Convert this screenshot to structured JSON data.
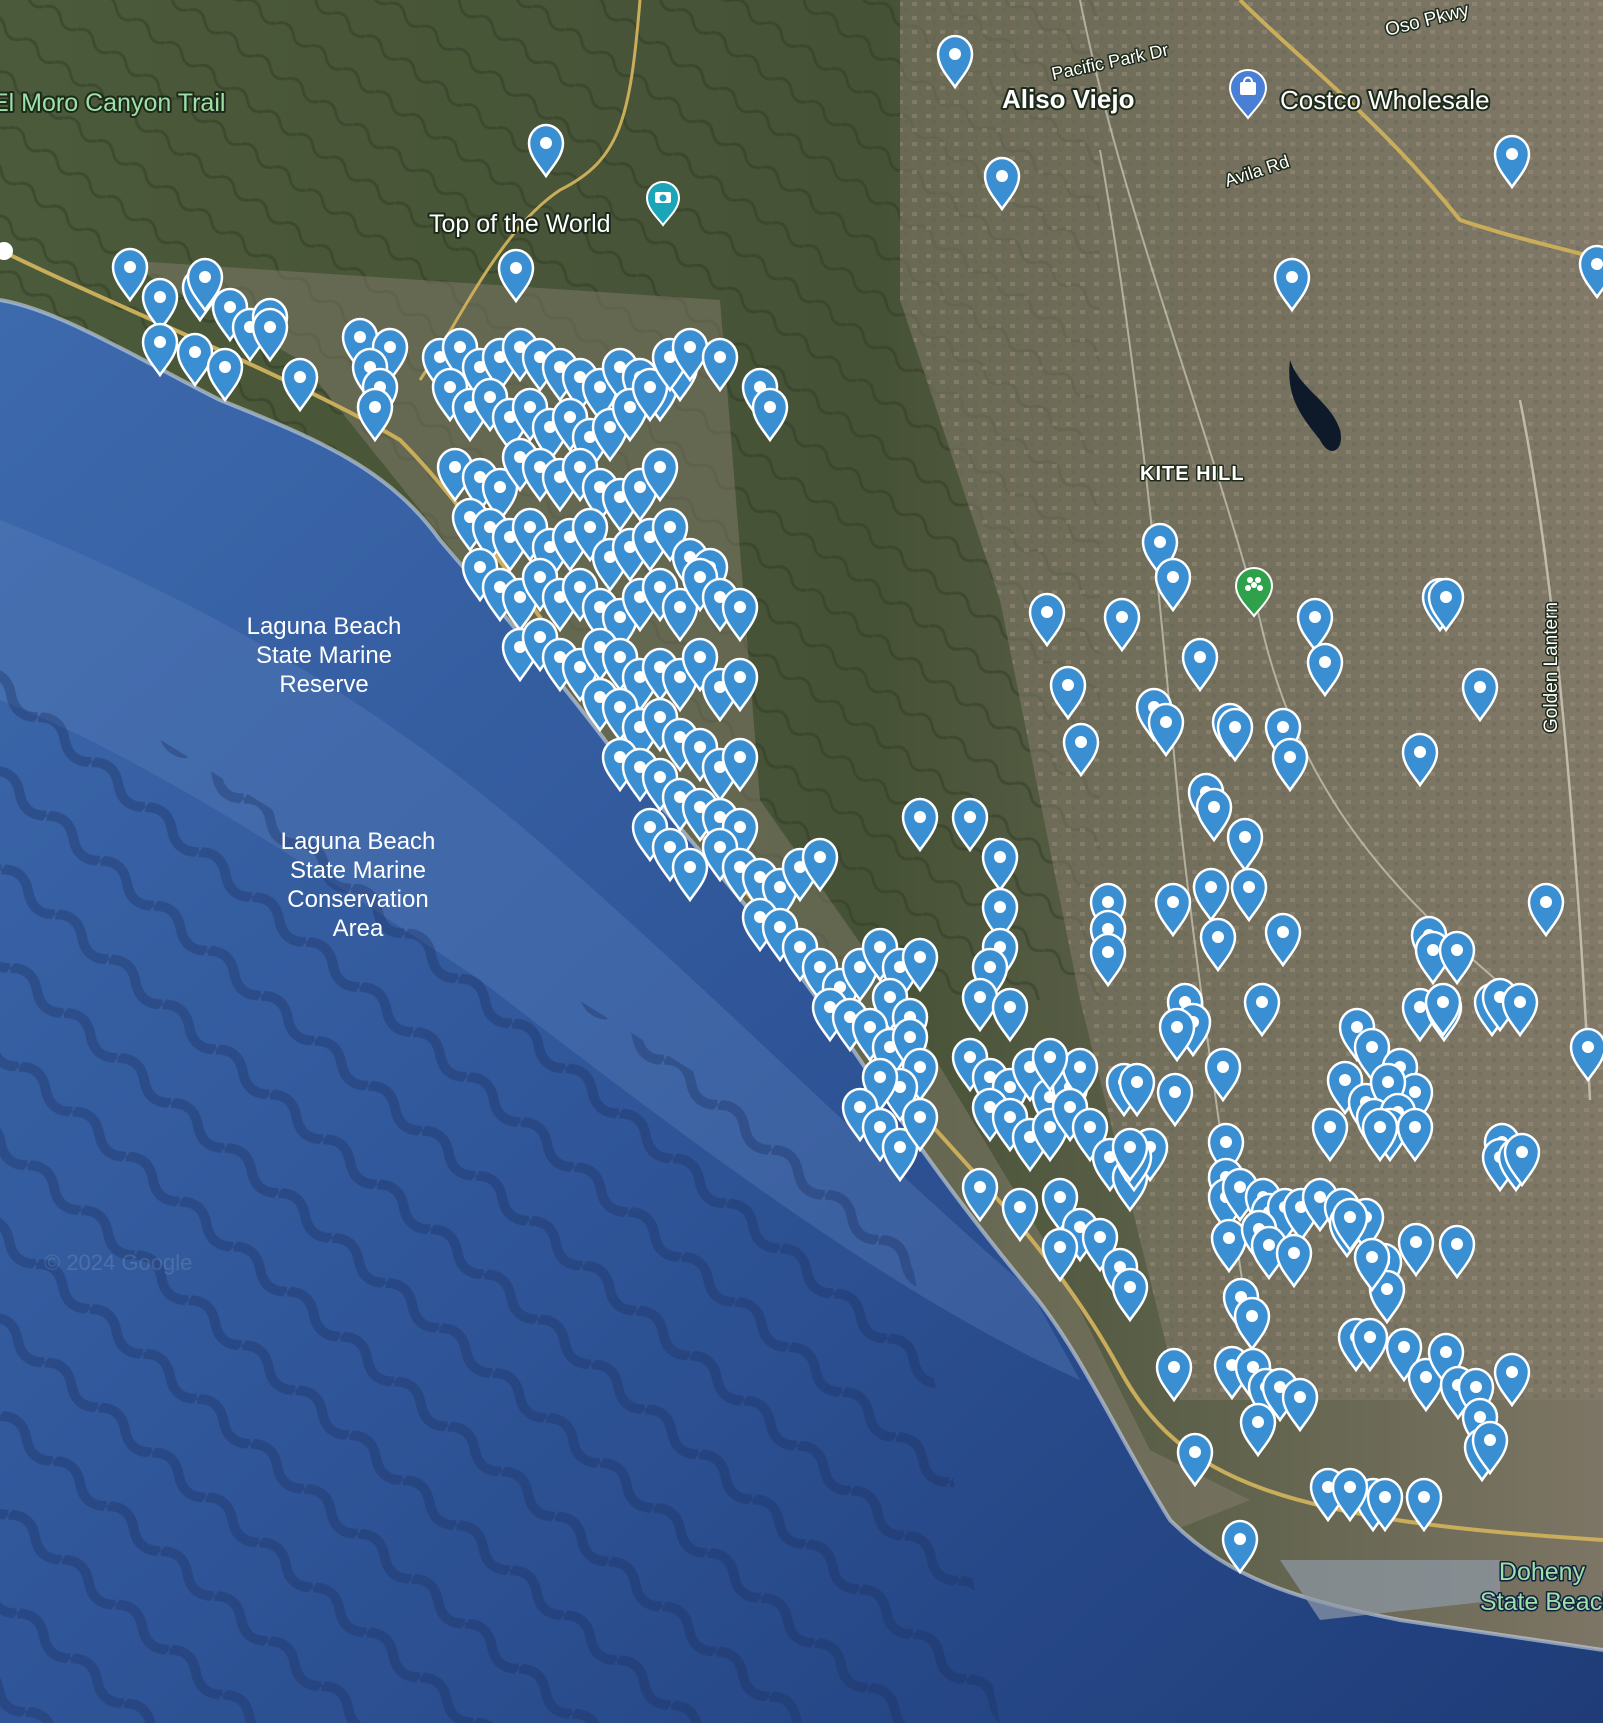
{
  "map": {
    "type": "satellite",
    "labels": {
      "el_moro": "El Moro Canyon Trail",
      "top_world": "Top of the World",
      "aliso_viejo": "Aliso Viejo",
      "pacific_park": "Pacific Park Dr",
      "oso_pkwy": "Oso Pkwy",
      "costco": "Costco Wholesale",
      "avila": "Avila Rd",
      "kite_hill": "KITE HILL",
      "golden_lantern": "Golden Lantern",
      "lb_reserve_1": "Laguna Beach",
      "lb_reserve_2": "State Marine",
      "lb_reserve_3": "Reserve",
      "lb_cons_1": "Laguna Beach",
      "lb_cons_2": "State Marine",
      "lb_cons_3": "Conservation",
      "lb_cons_4": "Area",
      "doheny_1": "Doheny",
      "doheny_2": "State Beach",
      "copyright": "© 2024 Google"
    },
    "colors": {
      "pin": "#3a8fd3",
      "ocean_deep": "#2a4a8a",
      "ocean_shallow": "#5a82c0",
      "land": "#4f5a3c",
      "urban": "#8a8070",
      "park_text": "#9de0a8",
      "road": "#c9ad5a"
    },
    "icons": [
      "camera-poi-icon",
      "shopping-poi-icon",
      "park-poi-icon"
    ],
    "marker_count": 323
  }
}
